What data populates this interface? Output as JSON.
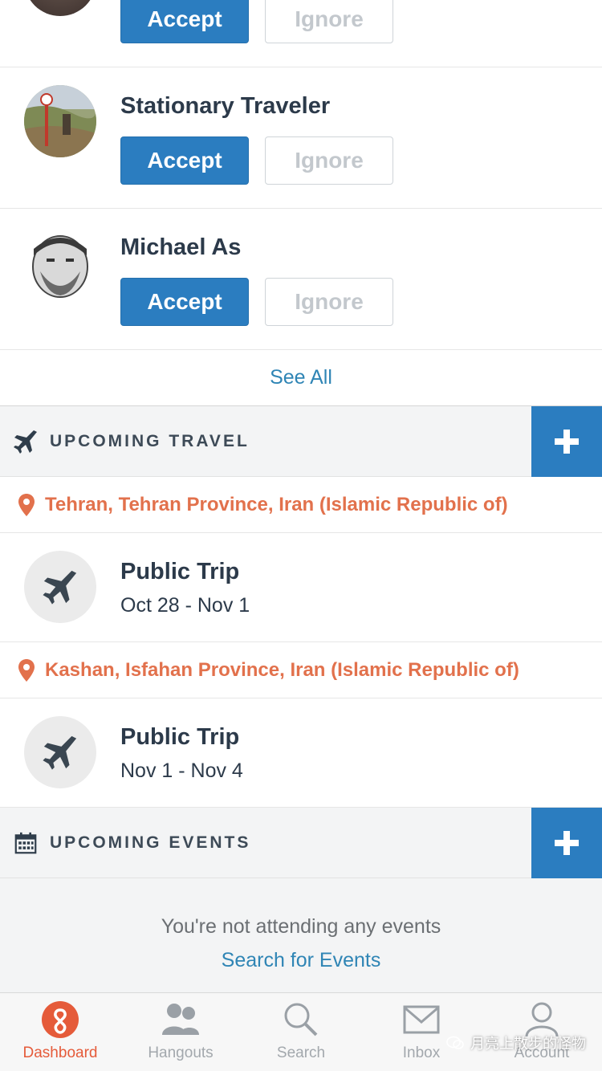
{
  "requests": [
    {
      "name": "",
      "accept_label": "Accept",
      "ignore_label": "Ignore"
    },
    {
      "name": "Stationary Traveler",
      "accept_label": "Accept",
      "ignore_label": "Ignore"
    },
    {
      "name": "Michael As",
      "accept_label": "Accept",
      "ignore_label": "Ignore"
    }
  ],
  "see_all_label": "See All",
  "travel": {
    "title": "UPCOMING TRAVEL",
    "icon": "airplane-icon",
    "trips": [
      {
        "location": "Tehran, Tehran Province, Iran (Islamic Republic of)",
        "title": "Public Trip",
        "dates": "Oct 28 - Nov 1"
      },
      {
        "location": "Kashan, Isfahan Province, Iran (Islamic Republic of)",
        "title": "Public Trip",
        "dates": "Nov 1 - Nov 4"
      }
    ]
  },
  "events": {
    "title": "UPCOMING EVENTS",
    "icon": "calendar-icon",
    "empty_text": "You're not attending any events",
    "search_link": "Search for Events"
  },
  "tabs": [
    {
      "label": "Dashboard",
      "icon": "dashboard-logo-icon",
      "active": true
    },
    {
      "label": "Hangouts",
      "icon": "people-icon",
      "active": false
    },
    {
      "label": "Search",
      "icon": "search-icon",
      "active": false
    },
    {
      "label": "Inbox",
      "icon": "envelope-icon",
      "active": false
    },
    {
      "label": "Account",
      "icon": "user-icon",
      "active": false
    }
  ],
  "watermark": "月亮上散步的怪物",
  "colors": {
    "accent": "#2b7dc0",
    "location": "#e2714c",
    "active_tab": "#e55b3a",
    "link": "#2f85b5"
  }
}
